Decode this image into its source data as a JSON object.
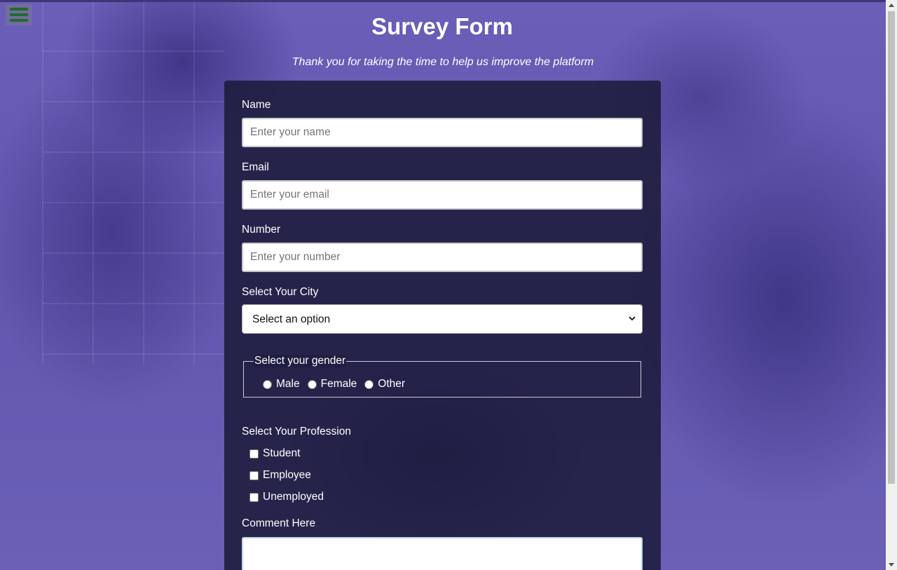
{
  "header": {
    "title": "Survey Form",
    "description": "Thank you for taking the time to help us improve the platform"
  },
  "nav": {
    "menu_icon": "hamburger-menu-icon",
    "menu_icon_color": "#1f6b2c"
  },
  "form": {
    "name": {
      "label": "Name",
      "placeholder": "Enter your name",
      "value": ""
    },
    "email": {
      "label": "Email",
      "placeholder": "Enter your email",
      "value": ""
    },
    "number": {
      "label": "Number",
      "placeholder": "Enter your number",
      "value": ""
    },
    "city": {
      "label": "Select Your City",
      "selected": "Select an option"
    },
    "gender": {
      "legend": "Select your gender",
      "options": [
        "Male",
        "Female",
        "Other"
      ]
    },
    "profession": {
      "label": "Select Your Profession",
      "options": [
        "Student",
        "Employee",
        "Unemployed"
      ]
    },
    "comment": {
      "label": "Comment Here",
      "value": ""
    }
  },
  "colors": {
    "background_tint": "#5b4fa6",
    "card": "#1b1a38",
    "text": "#ffffff"
  }
}
